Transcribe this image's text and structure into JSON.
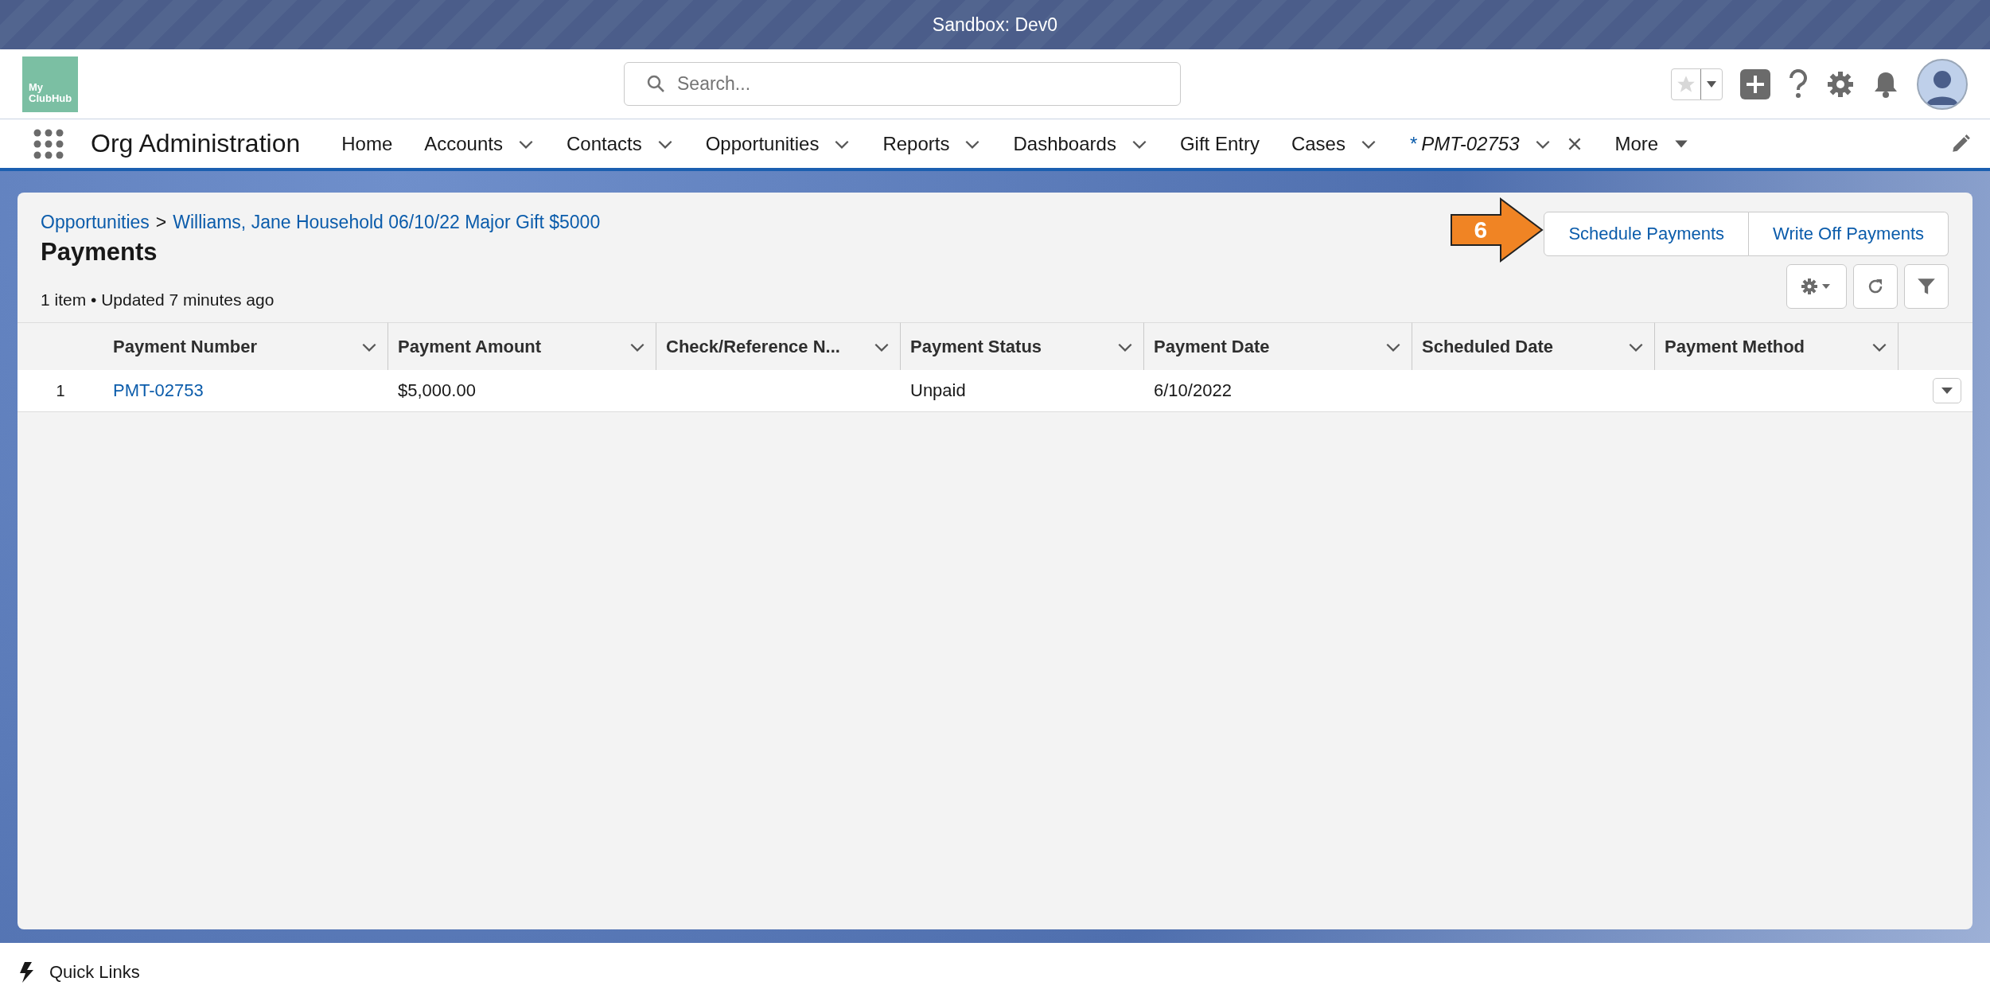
{
  "sandbox_bar": {
    "title": "Sandbox: Dev0"
  },
  "header": {
    "logo_text": [
      "My",
      "ClubHub"
    ],
    "search": {
      "placeholder": "Search..."
    }
  },
  "nav": {
    "app_name": "Org Administration",
    "items": [
      {
        "label": "Home",
        "kind": "link"
      },
      {
        "label": "Accounts",
        "kind": "menu"
      },
      {
        "label": "Contacts",
        "kind": "menu"
      },
      {
        "label": "Opportunities",
        "kind": "menu"
      },
      {
        "label": "Reports",
        "kind": "menu"
      },
      {
        "label": "Dashboards",
        "kind": "menu"
      },
      {
        "label": "Gift Entry",
        "kind": "link"
      },
      {
        "label": "Cases",
        "kind": "menu"
      },
      {
        "label": "PMT-02753",
        "kind": "record",
        "marker": "*"
      },
      {
        "label": "More",
        "kind": "more"
      }
    ]
  },
  "page": {
    "breadcrumb": [
      {
        "label": "Opportunities"
      },
      {
        "separator": ">",
        "label": "Williams, Jane Household 06/10/22 Major Gift $5000"
      }
    ],
    "title": "Payments",
    "meta": "1 item • Updated 7 minutes ago",
    "buttons": [
      "Schedule Payments",
      "Write Off Payments"
    ],
    "callout": {
      "number": "6"
    },
    "table": {
      "columns": [
        "Payment Number",
        "Payment Amount",
        "Check/Reference N...",
        "Payment Status",
        "Payment Date",
        "Scheduled Date",
        "Payment Method"
      ],
      "rows": [
        {
          "number": "1",
          "cells": [
            "PMT-02753",
            "$5,000.00",
            "",
            "Unpaid",
            "6/10/2022",
            "",
            ""
          ]
        }
      ]
    }
  },
  "footer": {
    "label": "Quick Links"
  }
}
